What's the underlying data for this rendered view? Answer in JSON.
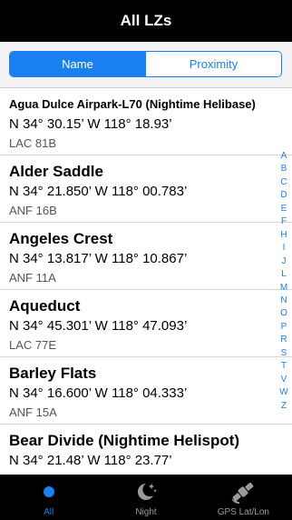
{
  "nav": {
    "title": "All LZs"
  },
  "segments": {
    "name": "Name",
    "proximity": "Proximity"
  },
  "items": [
    {
      "name": "Agua Dulce Airpark-L70 (Nightime Helibase)",
      "coords": "N 34° 30.15’ W 118° 18.93’",
      "code": "LAC 81B"
    },
    {
      "name": "Alder Saddle",
      "coords": "N 34° 21.850’ W 118° 00.783’",
      "code": "ANF 16B"
    },
    {
      "name": "Angeles Crest",
      "coords": "N 34° 13.817’ W 118° 10.867’",
      "code": "ANF 11A"
    },
    {
      "name": "Aqueduct",
      "coords": "N 34° 45.301’ W 118° 47.093’",
      "code": "LAC 77E"
    },
    {
      "name": "Barley Flats",
      "coords": "N 34° 16.600’ W 118° 04.333’",
      "code": "ANF 15A"
    },
    {
      "name": "Bear Divide (Nightime Helispot)",
      "coords": "N 34° 21.48’ W 118° 23.77’",
      "code": ""
    }
  ],
  "index_letters": [
    "A",
    "B",
    "C",
    "D",
    "E",
    "F",
    "H",
    "I",
    "J",
    "L",
    "M",
    "N",
    "O",
    "P",
    "R",
    "S",
    "T",
    "V",
    "W",
    "Z"
  ],
  "tabs": {
    "all": "All",
    "night": "Night",
    "gps": "GPS Lat/Lon"
  },
  "colors": {
    "accent": "#1a7ff0",
    "bar": "#000000"
  },
  "icons": {
    "all": "circle-icon",
    "night": "moon-stars-icon",
    "gps": "satellite-icon"
  }
}
